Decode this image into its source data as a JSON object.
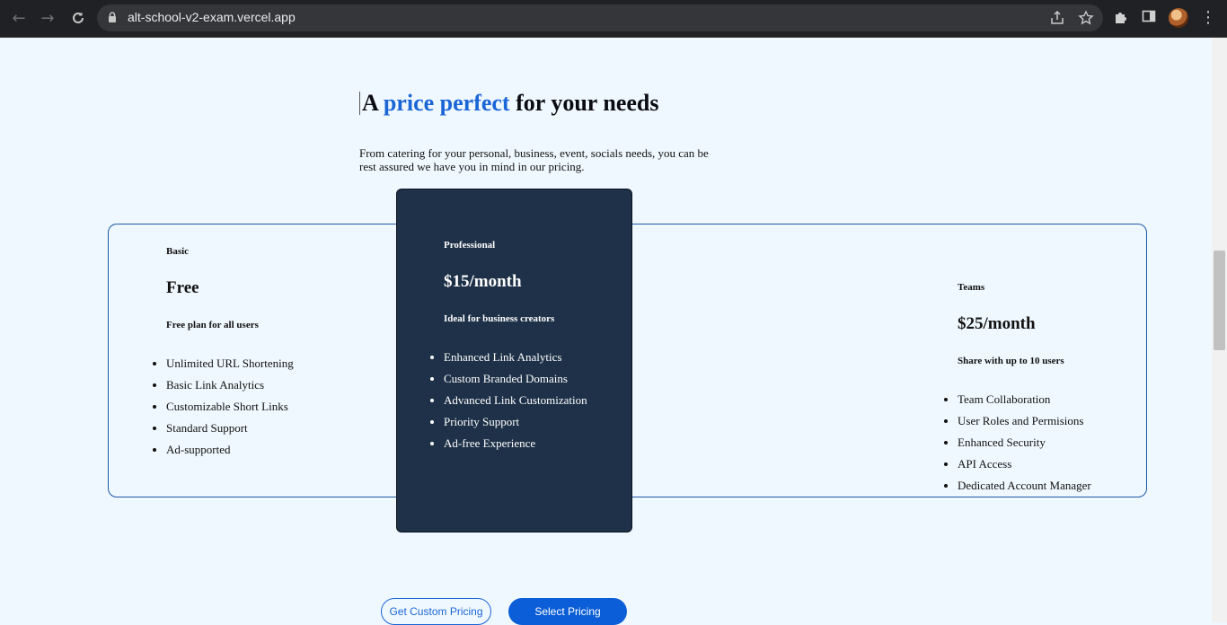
{
  "browser": {
    "url": "alt-school-v2-exam.vercel.app",
    "icons": [
      "back-icon",
      "forward-icon",
      "reload-icon",
      "lock-icon",
      "share-icon",
      "star-icon",
      "extensions-icon",
      "sidepanel-icon",
      "avatar",
      "menu-icon"
    ]
  },
  "hero": {
    "heading_pre": "A ",
    "heading_highlight": "price perfect",
    "heading_post": " for your needs",
    "intro": "From catering for your personal, business, event, socials needs, you can be rest assured we have you in mind in our pricing."
  },
  "plans": [
    {
      "name": "Basic",
      "price": "Free",
      "description": "Free plan for all users",
      "features": [
        "Unlimited URL Shortening",
        "Basic Link Analytics",
        "Customizable Short Links",
        "Standard Support",
        "Ad-supported"
      ]
    },
    {
      "name": "Professional",
      "price": "$15/month",
      "description": "Ideal for business creators",
      "features": [
        "Enhanced Link Analytics",
        "Custom Branded Domains",
        "Advanced Link Customization",
        "Priority Support",
        "Ad-free Experience"
      ]
    },
    {
      "name": "Teams",
      "price": "$25/month",
      "description": "Share with up to 10 users",
      "features": [
        "Team Collaboration",
        "User Roles and Permisions",
        "Enhanced Security",
        "API Access",
        "Dedicated Account Manager"
      ]
    }
  ],
  "actions": {
    "custom_label": "Get Custom Pricing",
    "select_label": "Select Pricing"
  },
  "colors": {
    "accent": "#1a66d6",
    "card_dark": "#1e3148",
    "page_bg": "#f0f8ff"
  }
}
